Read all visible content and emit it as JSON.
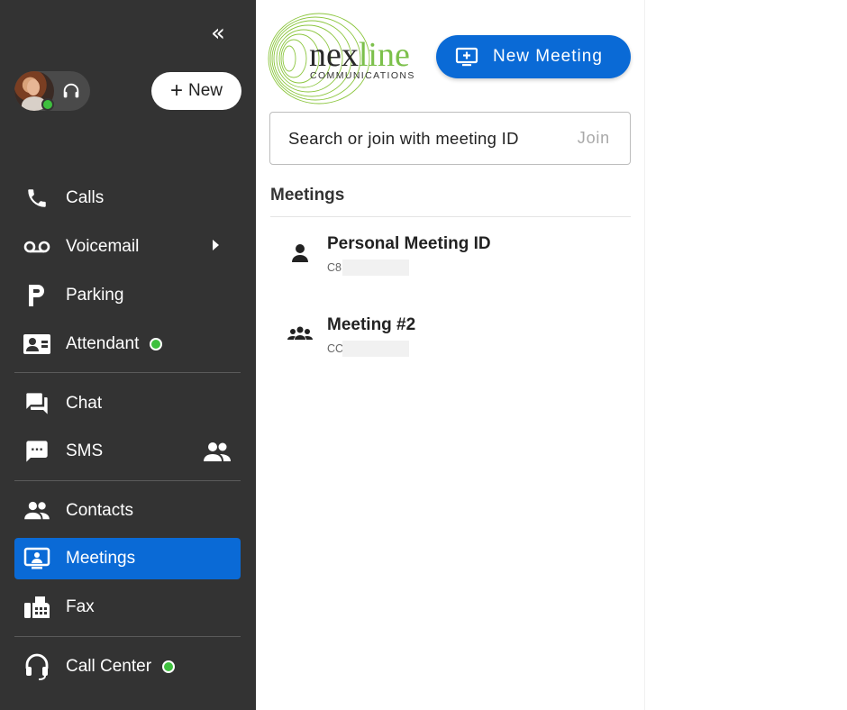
{
  "sidebar": {
    "new_label": "New",
    "items": {
      "calls": "Calls",
      "voicemail": "Voicemail",
      "parking": "Parking",
      "attendant": "Attendant",
      "chat": "Chat",
      "sms": "SMS",
      "contacts": "Contacts",
      "meetings": "Meetings",
      "fax": "Fax",
      "call_center": "Call Center"
    },
    "active_item": "Meetings"
  },
  "header": {
    "logo_main_dark": "nex",
    "logo_main_green": "line",
    "logo_sub": "COMMUNICATIONS",
    "new_meeting_label": "New Meeting"
  },
  "search": {
    "placeholder": "Search or join with meeting ID",
    "join_label": "Join"
  },
  "meetings": {
    "section_title": "Meetings",
    "list": [
      {
        "title": "Personal Meeting ID",
        "id_prefix": "C8"
      },
      {
        "title": "Meeting #2",
        "id_prefix": "CC"
      }
    ]
  },
  "colors": {
    "sidebar_bg": "#333333",
    "accent_blue": "#0a6ad6",
    "status_green": "#3ec03e",
    "logo_green": "#7cc04b"
  }
}
